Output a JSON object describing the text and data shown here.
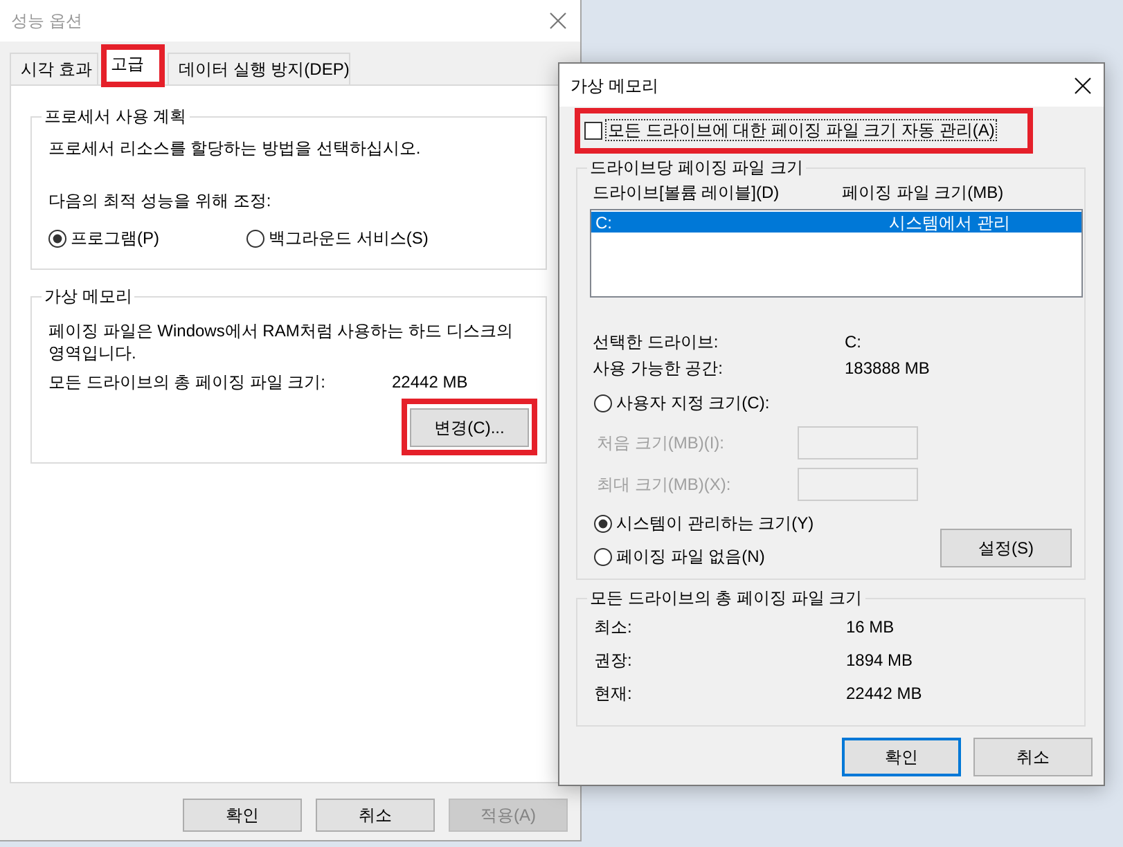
{
  "performance_options": {
    "title": "성능 옵션",
    "active": false,
    "tabs": [
      {
        "label": "시각 효과",
        "selected": false,
        "highlighted": false
      },
      {
        "label": "고급",
        "selected": true,
        "highlighted": true
      },
      {
        "label": "데이터 실행 방지(DEP)",
        "selected": false,
        "highlighted": false
      }
    ],
    "processor_scheduling": {
      "title": "프로세서 사용 계획",
      "description": "프로세서 리소스를 할당하는 방법을 선택하십시오.",
      "prompt": "다음의 최적 성능을 위해 조정:",
      "options": [
        {
          "label": "프로그램(P)",
          "selected": true
        },
        {
          "label": "백그라운드 서비스(S)",
          "selected": false
        }
      ]
    },
    "virtual_memory": {
      "title": "가상 메모리",
      "description": "페이징 파일은 Windows에서 RAM처럼 사용하는 하드 디스크의 영역입니다.",
      "total_label": "모든 드라이브의 총 페이징 파일 크기:",
      "total_value": "22442 MB",
      "change_button": {
        "label": "변경(C)...",
        "highlighted": true
      }
    },
    "buttons": [
      {
        "label": "확인",
        "disabled": false
      },
      {
        "label": "취소",
        "disabled": false
      },
      {
        "label": "적용(A)",
        "disabled": true
      }
    ]
  },
  "virtual_memory_dialog": {
    "title": "가상 메모리",
    "active": true,
    "auto_manage": {
      "label": "모든 드라이브에 대한 페이징 파일 크기 자동 관리(A)",
      "checked": false,
      "focused": true,
      "highlighted": true
    },
    "per_drive": {
      "title": "드라이브당 페이징 파일 크기",
      "columns": [
        "드라이브[볼륨 레이블](D)",
        "페이징 파일 크기(MB)"
      ],
      "rows": [
        {
          "drive": "C:",
          "size": "시스템에서 관리",
          "selected": true
        }
      ],
      "details": [
        {
          "label": "선택한 드라이브:",
          "value": "C:"
        },
        {
          "label": "사용 가능한 공간:",
          "value": "183888 MB"
        }
      ],
      "size_options": [
        {
          "label": "사용자 지정 크기(C):",
          "selected": false,
          "fields": [
            {
              "label": "처음 크기(MB)(I):",
              "disabled": true
            },
            {
              "label": "최대 크기(MB)(X):",
              "disabled": true
            }
          ]
        },
        {
          "label": "시스템이 관리하는 크기(Y)",
          "selected": true
        },
        {
          "label": "페이징 파일 없음(N)",
          "selected": false
        }
      ],
      "set_button": "설정(S)"
    },
    "totals": {
      "title": "모든 드라이브의 총 페이징 파일 크기",
      "rows": [
        {
          "label": "최소:",
          "value": "16 MB"
        },
        {
          "label": "권장:",
          "value": "1894 MB"
        },
        {
          "label": "현재:",
          "value": "22442 MB"
        }
      ]
    },
    "buttons": [
      {
        "label": "확인",
        "default": true
      },
      {
        "label": "취소",
        "default": false
      }
    ]
  }
}
